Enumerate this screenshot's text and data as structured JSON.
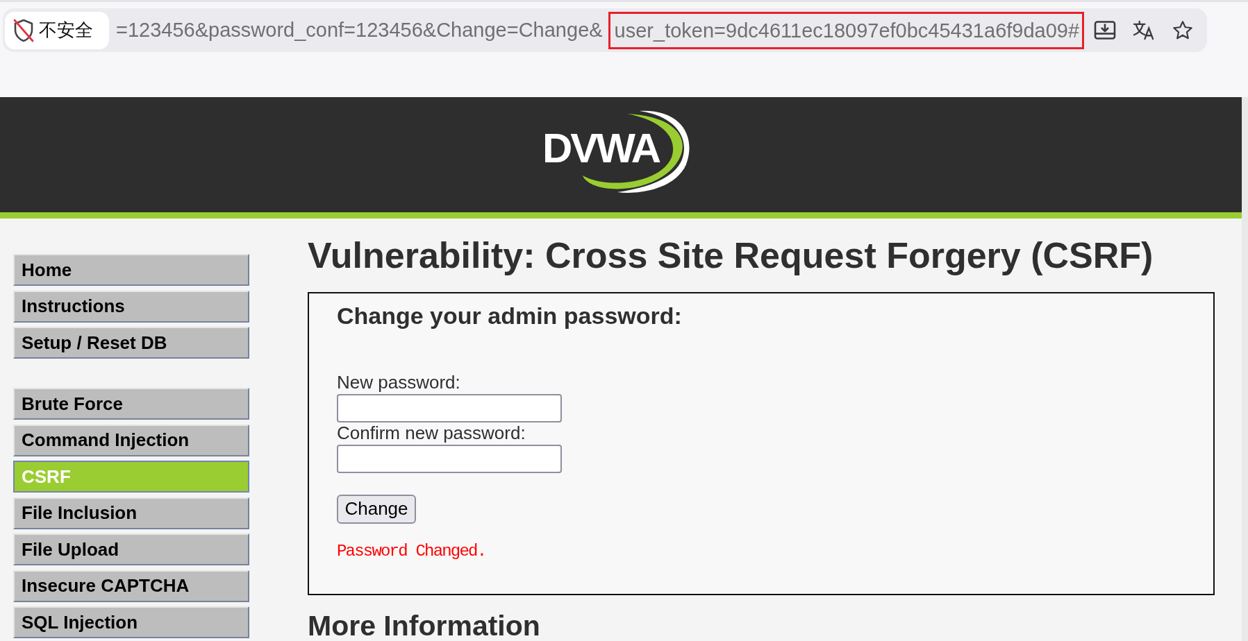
{
  "browser": {
    "security_label": "不安全",
    "url_segments": [
      {
        "text": "=123456&password_conf=123456&Change=Change&",
        "highlighted": false
      },
      {
        "text": "user_token=9dc4611ec18097ef0bc45431a6f9da09#",
        "highlighted": true
      }
    ]
  },
  "header": {
    "logo_text": "DVWA"
  },
  "sidebar": {
    "groups": [
      {
        "items": [
          {
            "label": "Home",
            "selected": false
          },
          {
            "label": "Instructions",
            "selected": false
          },
          {
            "label": "Setup / Reset DB",
            "selected": false
          }
        ]
      },
      {
        "items": [
          {
            "label": "Brute Force",
            "selected": false
          },
          {
            "label": "Command Injection",
            "selected": false
          },
          {
            "label": "CSRF",
            "selected": true
          },
          {
            "label": "File Inclusion",
            "selected": false
          },
          {
            "label": "File Upload",
            "selected": false
          },
          {
            "label": "Insecure CAPTCHA",
            "selected": false
          },
          {
            "label": "SQL Injection",
            "selected": false
          }
        ]
      }
    ]
  },
  "main": {
    "title": "Vulnerability: Cross Site Request Forgery (CSRF)",
    "form": {
      "heading": "Change your admin password:",
      "fields": [
        {
          "label": "New password:"
        },
        {
          "label": "Confirm new password:"
        }
      ],
      "button": "Change",
      "message": "Password Changed."
    },
    "section_heading": "More Information"
  }
}
